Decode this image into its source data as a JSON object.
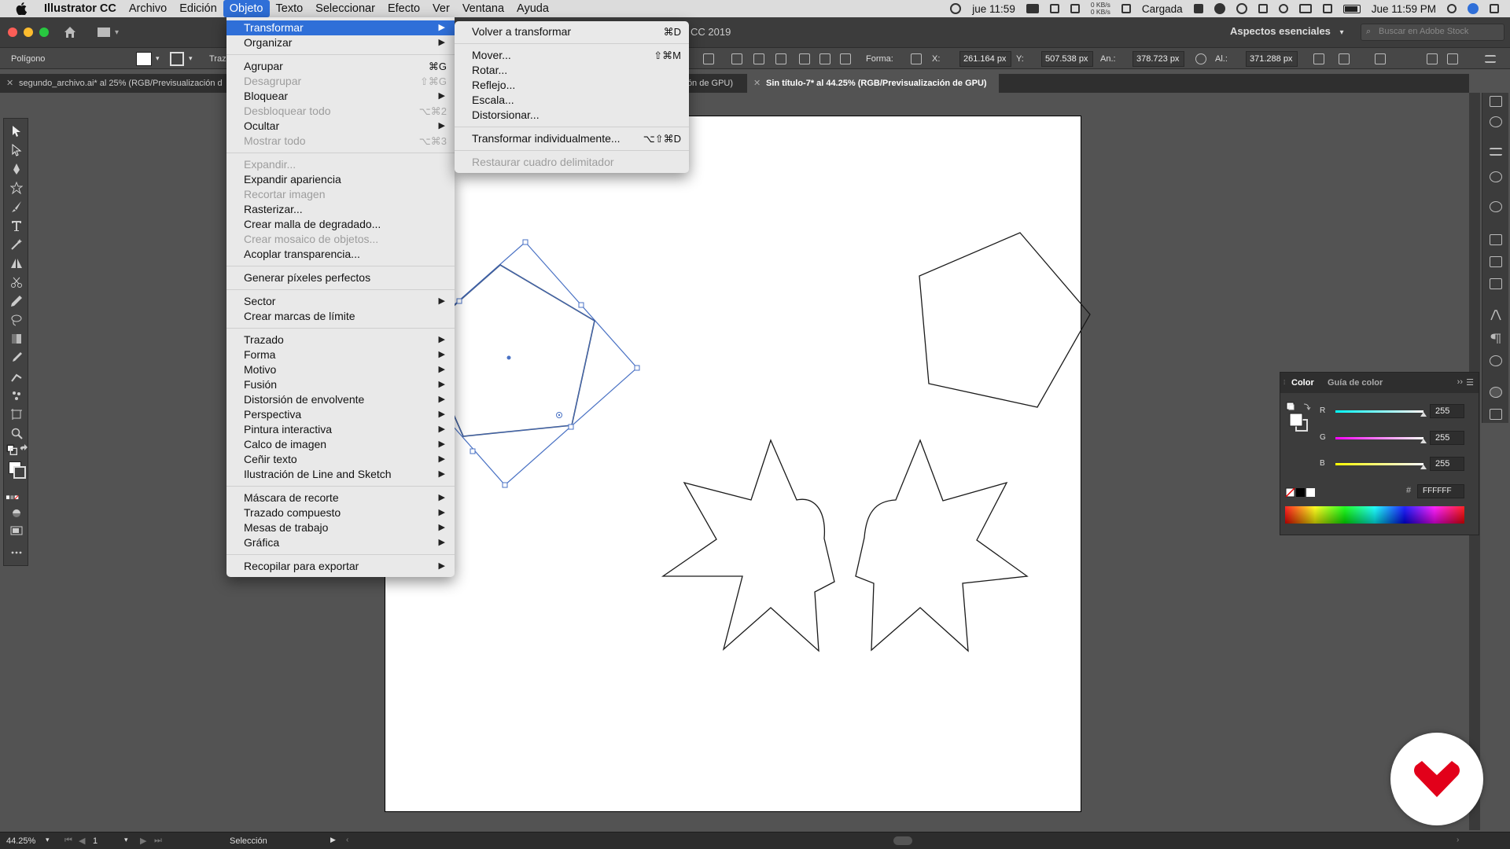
{
  "menubar": {
    "app_name": "Illustrator CC",
    "menus": [
      "Archivo",
      "Edición",
      "Objeto",
      "Texto",
      "Seleccionar",
      "Efecto",
      "Ver",
      "Ventana",
      "Ayuda"
    ],
    "active_menu": "Objeto",
    "status_time_left": "jue 11:59",
    "net_up": "0 KB/s",
    "net_down": "0 KB/s",
    "battery_label": "Cargada",
    "clock": "Jue 11:59 PM"
  },
  "appbar": {
    "title_suffix": "CC 2019",
    "workspace": "Aspectos esenciales",
    "stock_placeholder": "Buscar en Adobe Stock"
  },
  "controlbar": {
    "selection_type": "Polígono",
    "stroke_label": "Traz",
    "shape_label": "Forma:",
    "x_label": "X:",
    "x_value": "261.164 px",
    "y_label": "Y:",
    "y_value": "507.538 px",
    "w_label": "An.:",
    "w_value": "378.723 px",
    "h_label": "Al.:",
    "h_value": "371.288 px"
  },
  "doctabs": [
    {
      "label": "segundo_archivo.ai* al 25% (RGB/Previsualización d",
      "active": false
    },
    {
      "label": "ción de GPU)",
      "active": false
    },
    {
      "label": "Sin título-7* al 44.25% (RGB/Previsualización de GPU)",
      "active": true
    }
  ],
  "objeto_menu": {
    "items": [
      {
        "label": "Transformar",
        "submenu": true,
        "highlighted": true
      },
      {
        "label": "Organizar",
        "submenu": true
      },
      {
        "sep": true
      },
      {
        "label": "Agrupar",
        "shortcut": "⌘G"
      },
      {
        "label": "Desagrupar",
        "shortcut": "⇧⌘G",
        "disabled": true
      },
      {
        "label": "Bloquear",
        "submenu": true
      },
      {
        "label": "Desbloquear todo",
        "shortcut": "⌥⌘2",
        "disabled": true
      },
      {
        "label": "Ocultar",
        "submenu": true
      },
      {
        "label": "Mostrar todo",
        "shortcut": "⌥⌘3",
        "disabled": true
      },
      {
        "sep": true
      },
      {
        "label": "Expandir...",
        "disabled": true
      },
      {
        "label": "Expandir apariencia"
      },
      {
        "label": "Recortar imagen",
        "disabled": true
      },
      {
        "label": "Rasterizar..."
      },
      {
        "label": "Crear malla de degradado..."
      },
      {
        "label": "Crear mosaico de objetos...",
        "disabled": true
      },
      {
        "label": "Acoplar transparencia..."
      },
      {
        "sep": true
      },
      {
        "label": "Generar píxeles perfectos"
      },
      {
        "sep": true
      },
      {
        "label": "Sector",
        "submenu": true
      },
      {
        "label": "Crear marcas de límite"
      },
      {
        "sep": true
      },
      {
        "label": "Trazado",
        "submenu": true
      },
      {
        "label": "Forma",
        "submenu": true
      },
      {
        "label": "Motivo",
        "submenu": true
      },
      {
        "label": "Fusión",
        "submenu": true
      },
      {
        "label": "Distorsión de envolvente",
        "submenu": true
      },
      {
        "label": "Perspectiva",
        "submenu": true
      },
      {
        "label": "Pintura interactiva",
        "submenu": true
      },
      {
        "label": "Calco de imagen",
        "submenu": true
      },
      {
        "label": "Ceñir texto",
        "submenu": true
      },
      {
        "label": "Ilustración de Line and Sketch",
        "submenu": true
      },
      {
        "sep": true
      },
      {
        "label": "Máscara de recorte",
        "submenu": true
      },
      {
        "label": "Trazado compuesto",
        "submenu": true
      },
      {
        "label": "Mesas de trabajo",
        "submenu": true
      },
      {
        "label": "Gráfica",
        "submenu": true
      },
      {
        "sep": true
      },
      {
        "label": "Recopilar para exportar",
        "submenu": true
      }
    ]
  },
  "transform_submenu": {
    "items": [
      {
        "label": "Volver a transformar",
        "shortcut": "⌘D"
      },
      {
        "sep": true
      },
      {
        "label": "Mover...",
        "shortcut": "⇧⌘M"
      },
      {
        "label": "Rotar..."
      },
      {
        "label": "Reflejo..."
      },
      {
        "label": "Escala..."
      },
      {
        "label": "Distorsionar..."
      },
      {
        "sep": true
      },
      {
        "label": "Transformar individualmente...",
        "shortcut": "⌥⇧⌘D"
      },
      {
        "sep": true
      },
      {
        "label": "Restaurar cuadro delimitador",
        "disabled": true
      }
    ]
  },
  "color_panel": {
    "tab_color": "Color",
    "tab_guide": "Guía de color",
    "r_label": "R",
    "r_value": "255",
    "g_label": "G",
    "g_value": "255",
    "b_label": "B",
    "b_value": "255",
    "hex_value": "FFFFFF"
  },
  "statusbar": {
    "zoom": "44.25%",
    "page": "1",
    "mode": "Selección"
  },
  "colors": {
    "menu_highlight": "#2f6fd8",
    "selection_blue": "#4a72c4",
    "logo_red": "#e2001a"
  }
}
